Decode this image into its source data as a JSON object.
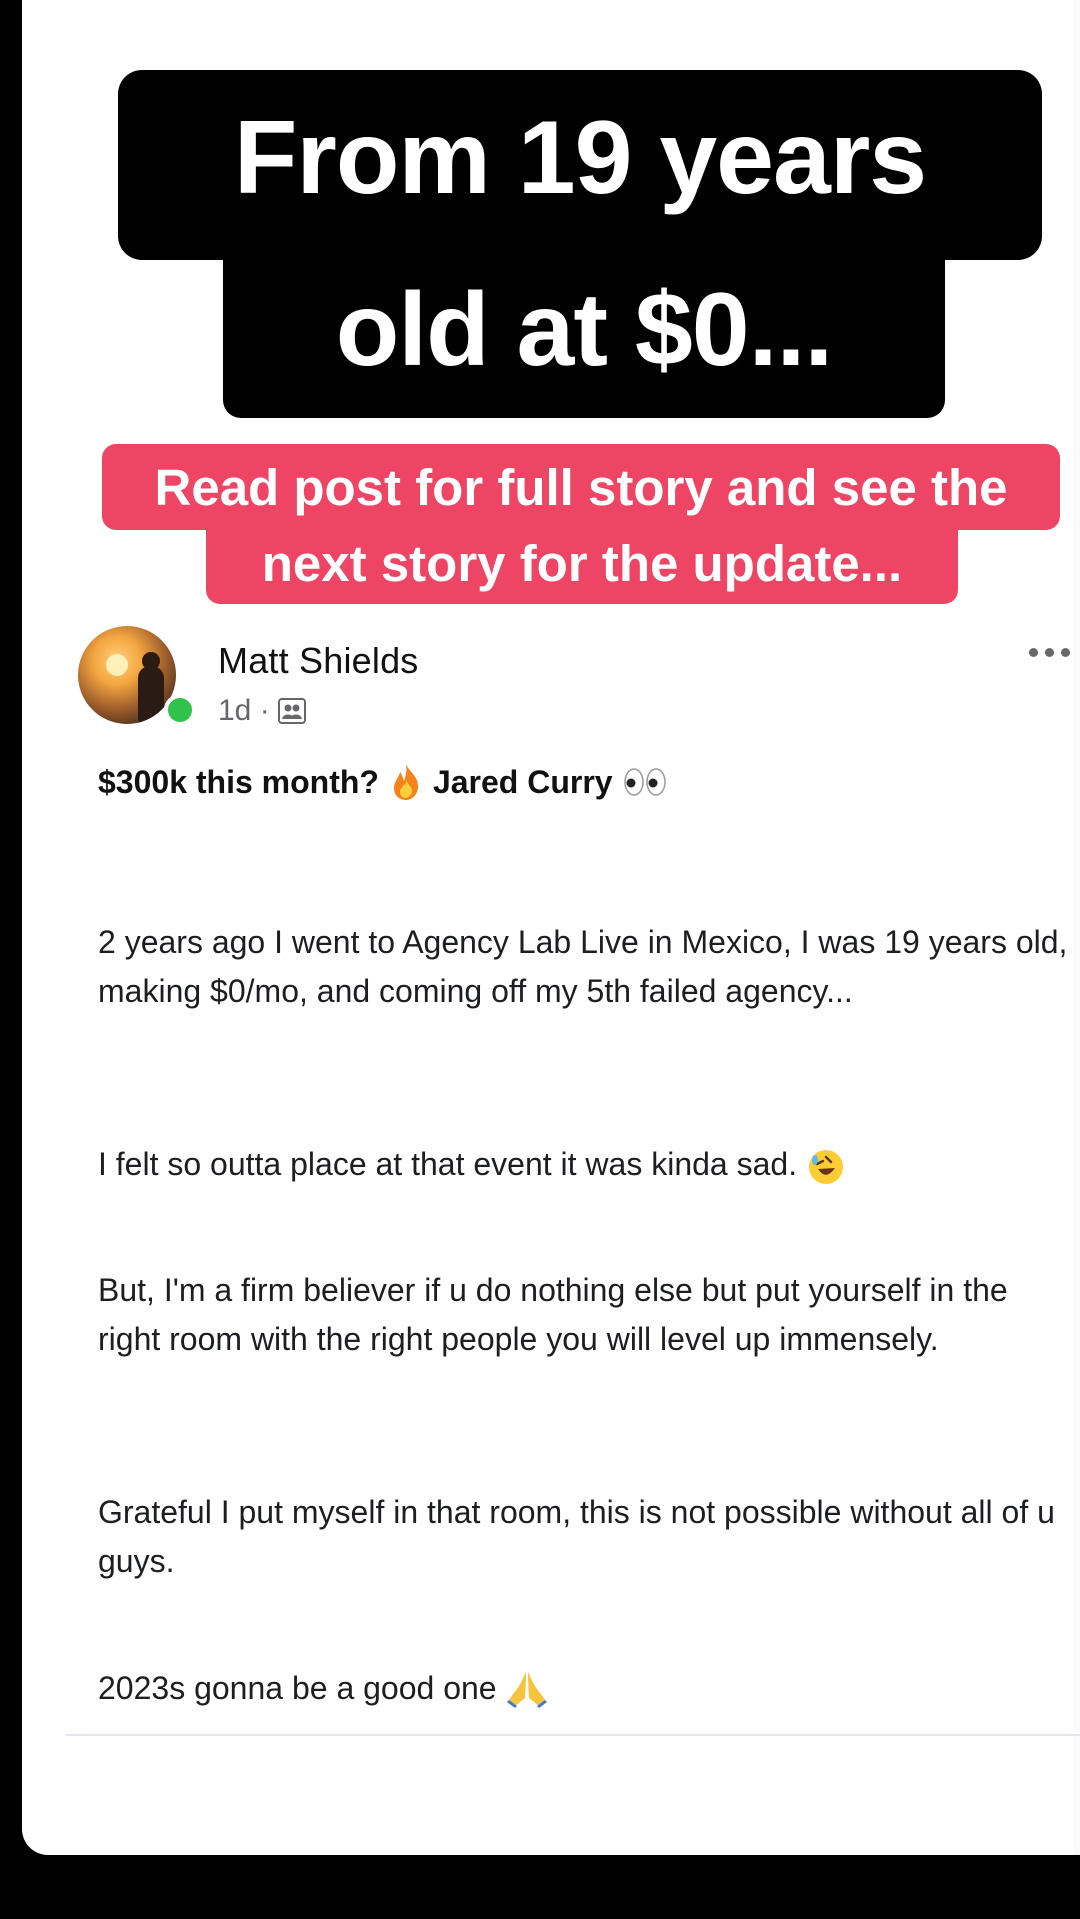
{
  "overlay": {
    "headline_line1": "From 19 years",
    "headline_line2": "old at $0...",
    "subtitle_line1": "Read post for full story and see the",
    "subtitle_line2": "next story for the update...",
    "colors": {
      "headline_bg": "#000000",
      "subtitle_bg": "#ef4565"
    }
  },
  "post": {
    "author": "Matt Shields",
    "time": "1d ·",
    "audience_icon": "friends-icon",
    "title": {
      "text_before": "$300k this month?",
      "emoji1": "fire-icon",
      "text_after": "Jared Curry",
      "emoji2": "eyes-icon"
    },
    "paragraphs": [
      "2 years ago I went to Agency Lab Live in Mexico, I was 19 years old, making $0/mo, and coming off my 5th failed agency...",
      "I felt so outta place at that event it was kinda sad.",
      "But, I'm a firm believer if u do nothing else but put yourself in the right room with the right people you will level up immensely.",
      "Grateful I put myself in that room, this is not possible without all of u guys.",
      "2023s gonna be a good one"
    ],
    "emoji_laughing": "rolling-laughing-icon",
    "emoji_praying": "praying-hands-icon"
  }
}
